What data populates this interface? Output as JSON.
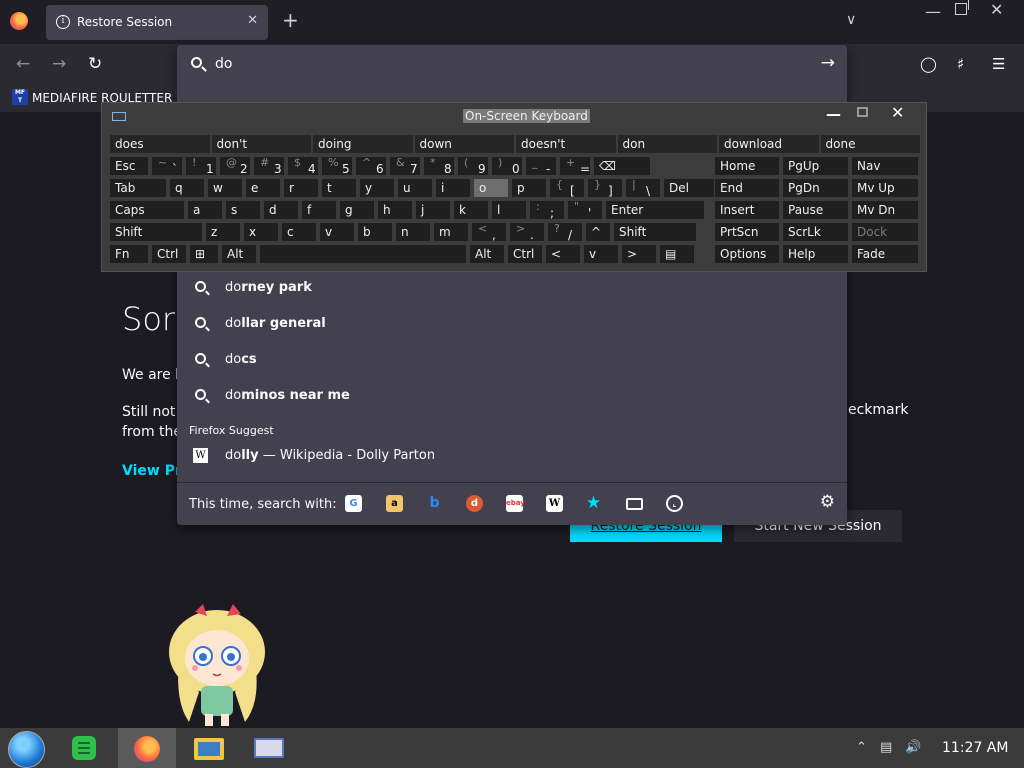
{
  "browser": {
    "tab_title": "Restore Session",
    "tab_close": "✕",
    "new_tab": "+",
    "bookmark_label": "MEDIAFIRE ROULETTER",
    "bookmark_icon_text": "MF T"
  },
  "urlbar": {
    "query": "do",
    "suggestions": [
      {
        "prefix": "do",
        "rest": "rney park"
      },
      {
        "prefix": "do",
        "rest": "llar general"
      },
      {
        "prefix": "do",
        "rest": "cs"
      },
      {
        "prefix": "do",
        "rest": "minos near me"
      }
    ],
    "firefox_suggest_heading": "Firefox Suggest",
    "wiki_suggestion": {
      "prefix": "do",
      "rest": "lly",
      "suffix": " — Wikipedia - Dolly Parton",
      "icon": "W"
    },
    "search_with_label": "This time, search with:",
    "engines": [
      "google",
      "amazon",
      "bing",
      "duckduckgo",
      "ebay",
      "wikipedia",
      "bookmarks",
      "tabs",
      "history"
    ]
  },
  "page": {
    "title": "Sorr",
    "p1": "We are h",
    "p2_line1": "Still not",
    "p2_line2": "from the",
    "p2_right": "eckmark",
    "link": "View Pro",
    "restore_label": "Restore Session",
    "new_session_label": "Start New Session"
  },
  "osk": {
    "title": "On-Screen Keyboard",
    "predictions": [
      "does",
      "don't",
      "doing",
      "down",
      "doesn't",
      "don",
      "download",
      "done"
    ],
    "row1": [
      {
        "sup": "",
        "main": "Esc"
      },
      {
        "sup": "~",
        "main": "`"
      },
      {
        "sup": "!",
        "main": "1"
      },
      {
        "sup": "@",
        "main": "2"
      },
      {
        "sup": "#",
        "main": "3"
      },
      {
        "sup": "$",
        "main": "4"
      },
      {
        "sup": "%",
        "main": "5"
      },
      {
        "sup": "^",
        "main": "6"
      },
      {
        "sup": "&",
        "main": "7"
      },
      {
        "sup": "*",
        "main": "8"
      },
      {
        "sup": "(",
        "main": "9"
      },
      {
        "sup": ")",
        "main": "0"
      },
      {
        "sup": "_",
        "main": "-"
      },
      {
        "sup": "+",
        "main": "="
      },
      {
        "sup": "",
        "main": "⌫"
      }
    ],
    "row2": [
      "Tab",
      "q",
      "w",
      "e",
      "r",
      "t",
      "y",
      "u",
      "i",
      "o",
      "p",
      "[",
      "]",
      "\\",
      "Del"
    ],
    "row2_sups": [
      "",
      "",
      "",
      "",
      "",
      "",
      "",
      "",
      "",
      "",
      "",
      "{",
      "}",
      "|",
      ""
    ],
    "row3": [
      "Caps",
      "a",
      "s",
      "d",
      "f",
      "g",
      "h",
      "j",
      "k",
      "l",
      ";",
      "'",
      "Enter"
    ],
    "row3_sups": [
      "",
      "",
      "",
      "",
      "",
      "",
      "",
      "",
      "",
      "",
      ":",
      "\"",
      ""
    ],
    "row4": [
      "Shift",
      "z",
      "x",
      "c",
      "v",
      "b",
      "n",
      "m",
      ",",
      ".",
      "/",
      "^",
      "Shift"
    ],
    "row4_sups": [
      "",
      "",
      "",
      "",
      "",
      "",
      "",
      "",
      "<",
      ">",
      "?",
      "",
      ""
    ],
    "row5": [
      "Fn",
      "Ctrl",
      "⊞",
      "Alt",
      "",
      "Alt",
      "Ctrl",
      "<",
      "v",
      ">",
      "▤"
    ],
    "nav": [
      [
        "Home",
        "PgUp",
        "Nav"
      ],
      [
        "End",
        "PgDn",
        "Mv Up"
      ],
      [
        "Insert",
        "Pause",
        "Mv Dn"
      ],
      [
        "PrtScn",
        "ScrLk",
        "Dock"
      ],
      [
        "Options",
        "Help",
        "Fade"
      ]
    ]
  },
  "taskbar": {
    "clock": "11:27 AM"
  },
  "colors": {
    "accent": "#00ddff",
    "panel": "#42414d",
    "keyboard_bg": "#3c3c3c",
    "key_bg": "#1f1f1f"
  }
}
